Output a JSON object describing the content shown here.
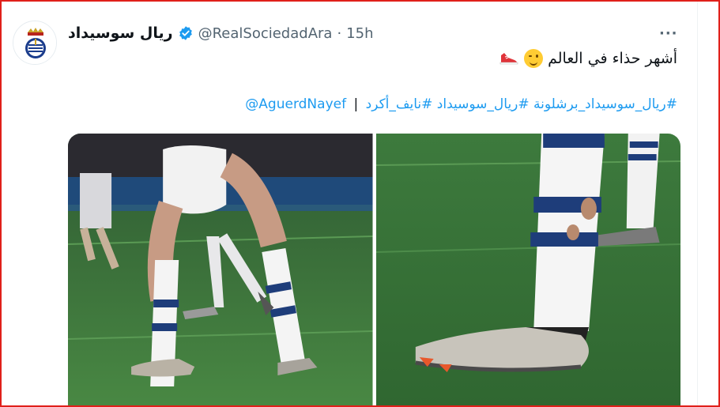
{
  "tweet": {
    "display_name": "ريال سوسيداد",
    "handle": "@RealSociedadAra",
    "separator": "·",
    "time": "15h",
    "more_label": "···",
    "text_line1": "أشهر حذاء في العالم",
    "hashtags": [
      "#ريال_سوسيداد_برشلونة",
      "#ريال_سوسيداد",
      "#نايف_أكرد"
    ],
    "separator_bar": "|",
    "mention": "@AguerdNayef"
  },
  "icons": {
    "avatar": "real-sociedad-crest",
    "verified": "verified-badge-icon",
    "more": "more-options-icon",
    "emoji1": "winking-face-emoji",
    "emoji2": "running-shoe-emoji"
  },
  "colors": {
    "link": "#1d9bf0",
    "verified": "#1d9bf0",
    "secondary_text": "#536471",
    "pitch": "#3f7a3a",
    "frame": "#e0201a"
  },
  "media": {
    "count": 2,
    "photos": [
      "football-player-legs-photo",
      "football-boot-closeup-photo"
    ]
  }
}
